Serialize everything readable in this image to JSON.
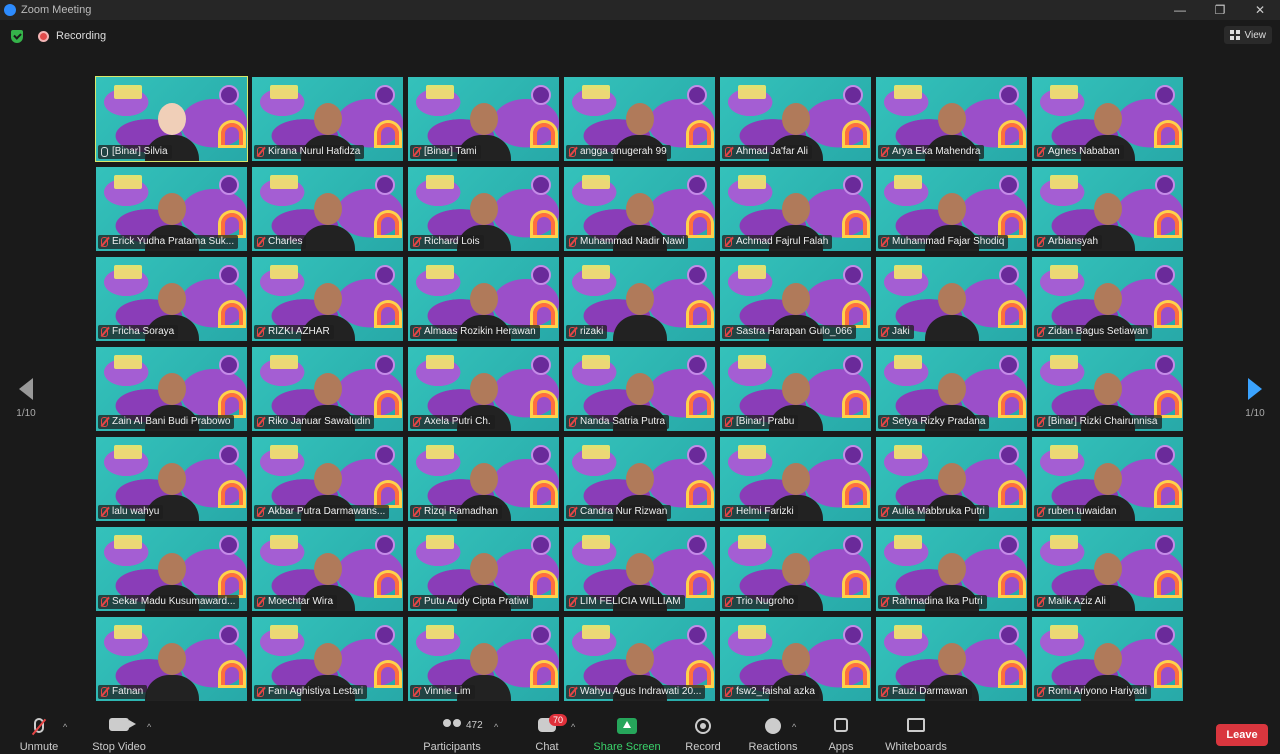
{
  "window": {
    "title": "Zoom Meeting",
    "controls": [
      "—",
      "❐",
      "✕"
    ]
  },
  "status": {
    "recording": "Recording",
    "view": "View"
  },
  "pager": {
    "left": "1/10",
    "right": "1/10"
  },
  "participants": [
    {
      "name": "[Binar] Silvia",
      "muted": false,
      "active": true
    },
    {
      "name": "Kirana Nurul Hafidza",
      "muted": true
    },
    {
      "name": "[Binar] Tami",
      "muted": true
    },
    {
      "name": "angga anugerah 99",
      "muted": true
    },
    {
      "name": "Ahmad Ja'far Ali",
      "muted": true
    },
    {
      "name": "Arya Eka Mahendra",
      "muted": true
    },
    {
      "name": "Agnes Nababan",
      "muted": true
    },
    {
      "name": "Erick Yudha Pratama Suk...",
      "muted": true
    },
    {
      "name": "Charles",
      "muted": true
    },
    {
      "name": "Richard Lois",
      "muted": true
    },
    {
      "name": "Muhammad Nadir Nawi",
      "muted": true
    },
    {
      "name": "Achmad Fajrul Falah",
      "muted": true
    },
    {
      "name": "Muhammad Fajar Shodiq",
      "muted": true
    },
    {
      "name": "Arbiansyah",
      "muted": true
    },
    {
      "name": "Fricha Soraya",
      "muted": true
    },
    {
      "name": "RIZKI AZHAR",
      "muted": true
    },
    {
      "name": "Almaas Rozikin Herawan",
      "muted": true
    },
    {
      "name": "rizaki",
      "muted": true
    },
    {
      "name": "Sastra Harapan Gulo_066",
      "muted": true
    },
    {
      "name": "Jaki",
      "muted": true
    },
    {
      "name": "Zidan Bagus Setiawan",
      "muted": true
    },
    {
      "name": "Zain Al Bani Budi Prabowo",
      "muted": true
    },
    {
      "name": "Riko Januar Sawaludin",
      "muted": true
    },
    {
      "name": "Axela Putri Ch.",
      "muted": true
    },
    {
      "name": "Nanda Satria Putra",
      "muted": true
    },
    {
      "name": "[Binar] Prabu",
      "muted": true
    },
    {
      "name": "Setya Rizky Pradana",
      "muted": true
    },
    {
      "name": "[Binar] Rizki Chairunnisa",
      "muted": true
    },
    {
      "name": "lalu wahyu",
      "muted": true
    },
    {
      "name": "Akbar Putra Darmawans...",
      "muted": true
    },
    {
      "name": "Rizqi Ramadhan",
      "muted": true
    },
    {
      "name": "Candra Nur Rizwan",
      "muted": true
    },
    {
      "name": "Helmi Farizki",
      "muted": true
    },
    {
      "name": "Aulia Mabbruka Putri",
      "muted": true
    },
    {
      "name": "ruben tuwaidan",
      "muted": true
    },
    {
      "name": "Sekar Madu Kusumaward...",
      "muted": true
    },
    {
      "name": "Moechtar Wira",
      "muted": true
    },
    {
      "name": "Putu Audy Cipta Pratiwi",
      "muted": true
    },
    {
      "name": "LIM FELICIA WILLIAM",
      "muted": true
    },
    {
      "name": "Trio Nugroho",
      "muted": true
    },
    {
      "name": "Rahmadina Ika Putri",
      "muted": true
    },
    {
      "name": "Malik Aziz Ali",
      "muted": true
    },
    {
      "name": "Fatnan",
      "muted": true
    },
    {
      "name": "Fani Aghistiya Lestari",
      "muted": true
    },
    {
      "name": "Vinnie Lim",
      "muted": true
    },
    {
      "name": "Wahyu Agus Indrawati 20...",
      "muted": true
    },
    {
      "name": "fsw2_faishal azka",
      "muted": true
    },
    {
      "name": "Fauzi Darmawan",
      "muted": true
    },
    {
      "name": "Romi Ariyono Hariyadi",
      "muted": true
    }
  ],
  "toolbar": {
    "unmute": "Unmute",
    "stop_video": "Stop Video",
    "participants": "Participants",
    "participant_count": "472",
    "chat": "Chat",
    "chat_badge": "70",
    "share_screen": "Share Screen",
    "record": "Record",
    "reactions": "Reactions",
    "apps": "Apps",
    "whiteboards": "Whiteboards",
    "leave": "Leave",
    "caret": "^"
  }
}
